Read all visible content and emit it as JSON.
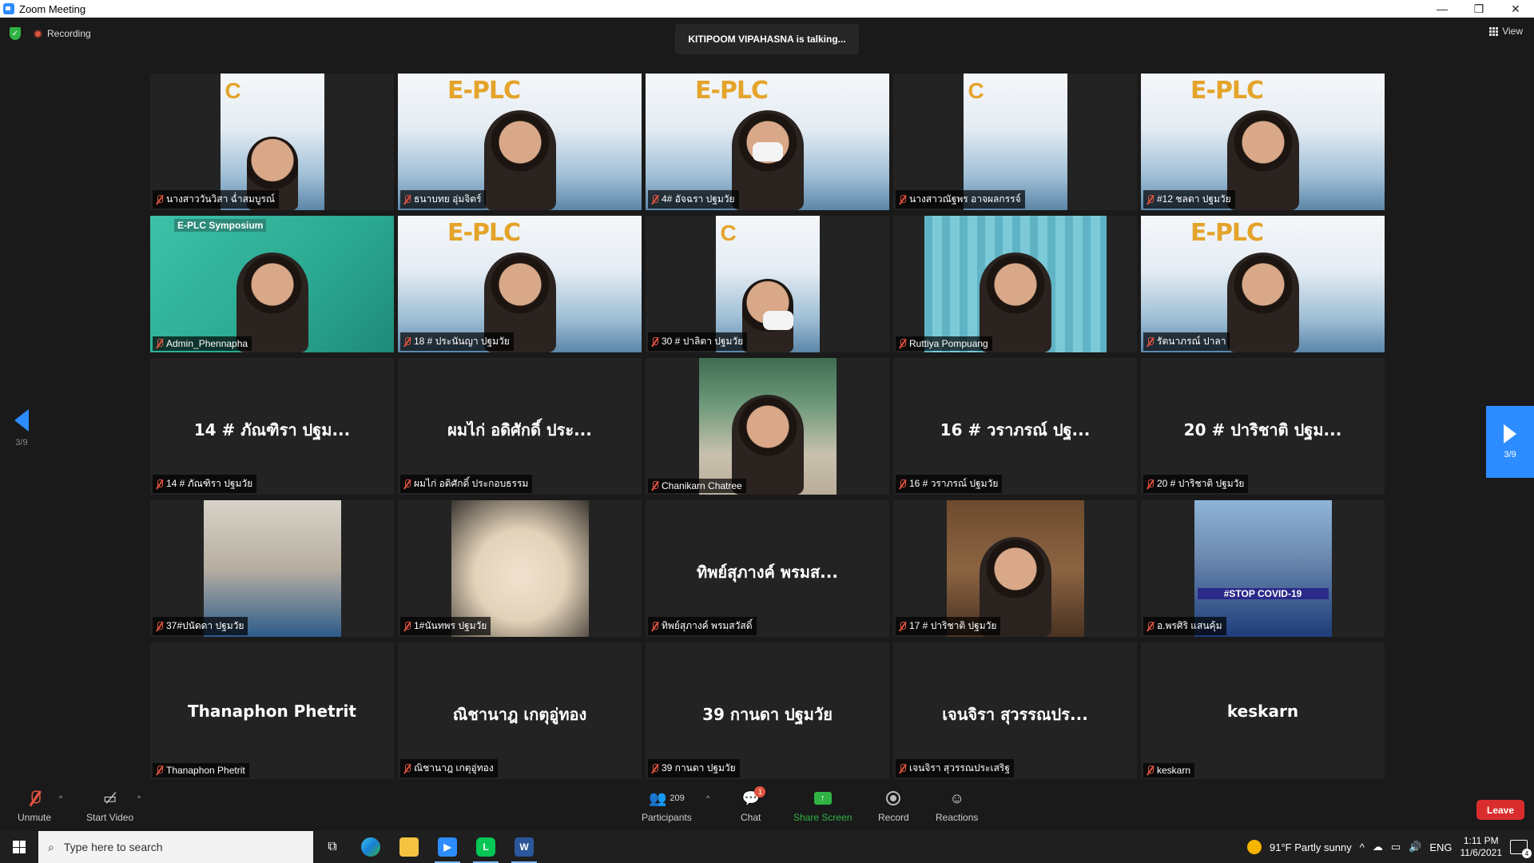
{
  "window": {
    "title": "Zoom Meeting",
    "controls": [
      "—",
      "❐",
      "✕"
    ]
  },
  "header": {
    "recording_label": "Recording",
    "talking": "KITIPOOM VIPAHASNA is talking...",
    "view_label": "View"
  },
  "pager": {
    "left_indicator": "3/9",
    "right_indicator": "3/9"
  },
  "tiles": [
    {
      "name": "นางสาววันวิสา ฉ่ำสมบูรณ์",
      "big": ""
    },
    {
      "name": "ธนาบทย อุ่มจิตร์",
      "big": ""
    },
    {
      "name": "4# อัจฉรา ปฐมวัย",
      "big": ""
    },
    {
      "name": "นางสาวณัฐพร อาจผลกรรจ์",
      "big": ""
    },
    {
      "name": "#12 ชลดา ปฐมวัย",
      "big": ""
    },
    {
      "name": "Admin_Phennapha",
      "big": ""
    },
    {
      "name": "18 # ประนันญา ปฐมวัย",
      "big": ""
    },
    {
      "name": "30 # ปาลิตา ปฐมวัย",
      "big": ""
    },
    {
      "name": "Ruttiya Pompuang",
      "big": ""
    },
    {
      "name": "รัตนาภรณ์ ปาลา",
      "big": ""
    },
    {
      "name": "14 # ภัณฑิรา ปฐมวัย",
      "big": "14 # ภัณฑิรา ปฐม..."
    },
    {
      "name": "ผมไก่ อดิศักดิ์ ประกอบธรรม",
      "big": "ผมไก่ อดิศักดิ์ ประ..."
    },
    {
      "name": "Chanikarn Chatree",
      "big": ""
    },
    {
      "name": "16 # วราภรณ์ ปฐมวัย",
      "big": "16 # วราภรณ์ ปฐ..."
    },
    {
      "name": "20 # ปาริชาติ ปฐมวัย",
      "big": "20 # ปาริชาติ ปฐม..."
    },
    {
      "name": "37#ปนัดดา ปฐมวัย",
      "big": ""
    },
    {
      "name": "1#นันทพร ปฐมวัย",
      "big": ""
    },
    {
      "name": "ทิพย์สุภางค์ พรมสวัสดิ์",
      "big": "ทิพย์สุภางค์ พรมส..."
    },
    {
      "name": "17 # ปาริชาติ ปฐมวัย",
      "big": ""
    },
    {
      "name": "อ.พรศิริ แสนคุ้ม",
      "big": ""
    },
    {
      "name": "Thanaphon Phetrit",
      "big": "Thanaphon Phetrit"
    },
    {
      "name": "ณิชานาฎ เกตุอู่ทอง",
      "big": "ณิชานาฎ เกตุอู่ทอง"
    },
    {
      "name": "39 กานดา ปฐมวัย",
      "big": "39 กานดา ปฐมวัย"
    },
    {
      "name": "เจนจิรา สุวรรณประเสริฐ",
      "big": "เจนจิรา สุวรรณปร..."
    },
    {
      "name": "keskarn",
      "big": "keskarn"
    }
  ],
  "video_overlays": {
    "plc_logo": "E-PLC",
    "zoom_logo": "C",
    "eplc_symposium": "E-PLC Symposium",
    "covid_text": "#STOP COVID-19"
  },
  "toolbar": {
    "unmute": "Unmute",
    "start_video": "Start Video",
    "participants": "Participants",
    "participants_count": "209",
    "chat": "Chat",
    "chat_badge": "1",
    "share_screen": "Share Screen",
    "record": "Record",
    "reactions": "Reactions",
    "leave": "Leave"
  },
  "taskbar": {
    "search_placeholder": "Type here to search",
    "weather": "91°F  Partly sunny",
    "language": "ENG",
    "time": "1:11 PM",
    "date": "11/6/2021",
    "notif_count": "4"
  },
  "colors": {
    "accent": "#2d8cff",
    "danger": "#d92d2d",
    "share": "#2fb344",
    "muted_icon": "#e0533f"
  }
}
